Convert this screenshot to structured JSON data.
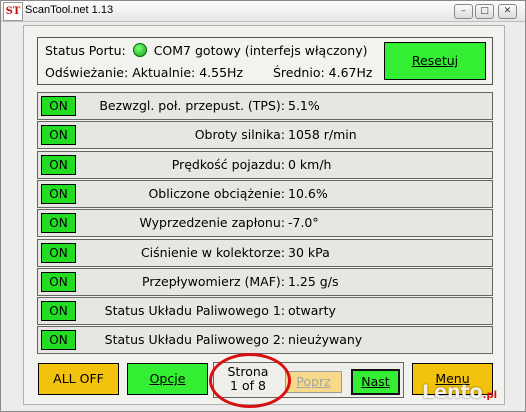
{
  "window": {
    "title": "ScanTool.net 1.13",
    "logo_text": "ST",
    "min_glyph": "–",
    "max_glyph": "□",
    "close_glyph": "✕"
  },
  "status": {
    "port_label": "Status Portu:",
    "port_value": "COM7 gotowy (interfejs włączony)",
    "refresh_label": "Odświeżanie:",
    "current_label": "Aktualnie:",
    "current_value": "4.55Hz",
    "average_label": "Średnio:",
    "average_value": "4.67Hz",
    "led_color": "#22cc22"
  },
  "reset_label": "Resetuj",
  "on_label": "ON",
  "sensors": [
    {
      "label": "Bezwzgl. poł. przepust. (TPS):",
      "value": "5.1%"
    },
    {
      "label": "Obroty silnika:",
      "value": "1058 r/min"
    },
    {
      "label": "Prędkość pojazdu:",
      "value": "0 km/h"
    },
    {
      "label": "Obliczone obciążenie:",
      "value": "10.6%"
    },
    {
      "label": "Wyprzedzenie zapłonu:",
      "value": "-7.0°"
    },
    {
      "label": "Ciśnienie w kolektorze:",
      "value": "30 kPa"
    },
    {
      "label": "Przepływomierz (MAF):",
      "value": "1.25 g/s"
    },
    {
      "label": "Status Układu Paliwowego 1:",
      "value": "otwarty"
    },
    {
      "label": "Status Układu Paliwowego 2:",
      "value": "nieużywany"
    }
  ],
  "bottom": {
    "all_off": "ALL OFF",
    "options": "Opcje",
    "page_word": "Strona",
    "page_of": "1 of 8",
    "prev": "Poprz",
    "next": "Nast",
    "menu": "Menu"
  },
  "watermark": {
    "text": "Lento",
    "suffix": ".pl"
  },
  "colors": {
    "on_green": "#22dd22",
    "button_green": "#33ee33",
    "button_yellow": "#f2c20c",
    "highlight_red": "#d81010"
  }
}
